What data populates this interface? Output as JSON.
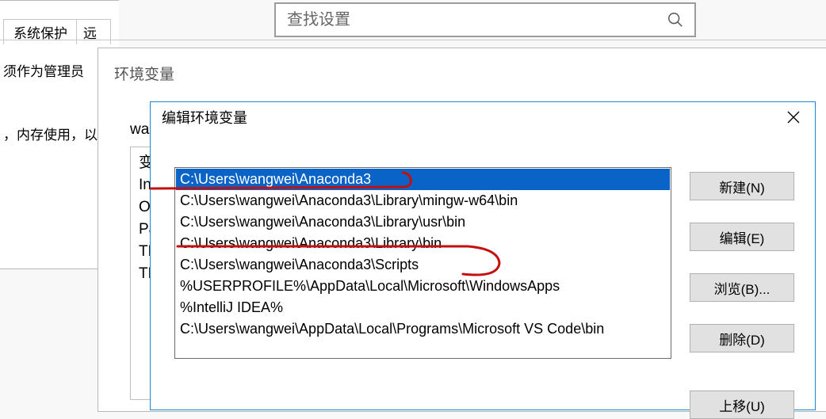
{
  "search": {
    "placeholder": "查找设置"
  },
  "envParent": {
    "title": "环境变量",
    "userLabel": "wang",
    "truncatedVars": [
      "变量",
      "Int",
      "On",
      "Pat",
      "TEI",
      "TM"
    ]
  },
  "sysPanel": {
    "tab1": "系统保护",
    "tab2": "远",
    "line1": "须作为管理员",
    "line2": "，内存使用，以"
  },
  "editDialog": {
    "title": "编辑环境变量",
    "paths": [
      "C:\\Users\\wangwei\\Anaconda3",
      "C:\\Users\\wangwei\\Anaconda3\\Library\\mingw-w64\\bin",
      "C:\\Users\\wangwei\\Anaconda3\\Library\\usr\\bin",
      "C:\\Users\\wangwei\\Anaconda3\\Library\\bin",
      "C:\\Users\\wangwei\\Anaconda3\\Scripts",
      "%USERPROFILE%\\AppData\\Local\\Microsoft\\WindowsApps",
      "%IntelliJ IDEA%",
      "C:\\Users\\wangwei\\AppData\\Local\\Programs\\Microsoft VS Code\\bin"
    ],
    "selectedIndex": 0,
    "buttons": {
      "new": "新建(N)",
      "edit": "编辑(E)",
      "browse": "浏览(B)...",
      "delete": "删除(D)",
      "moveUp": "上移(U)"
    }
  }
}
